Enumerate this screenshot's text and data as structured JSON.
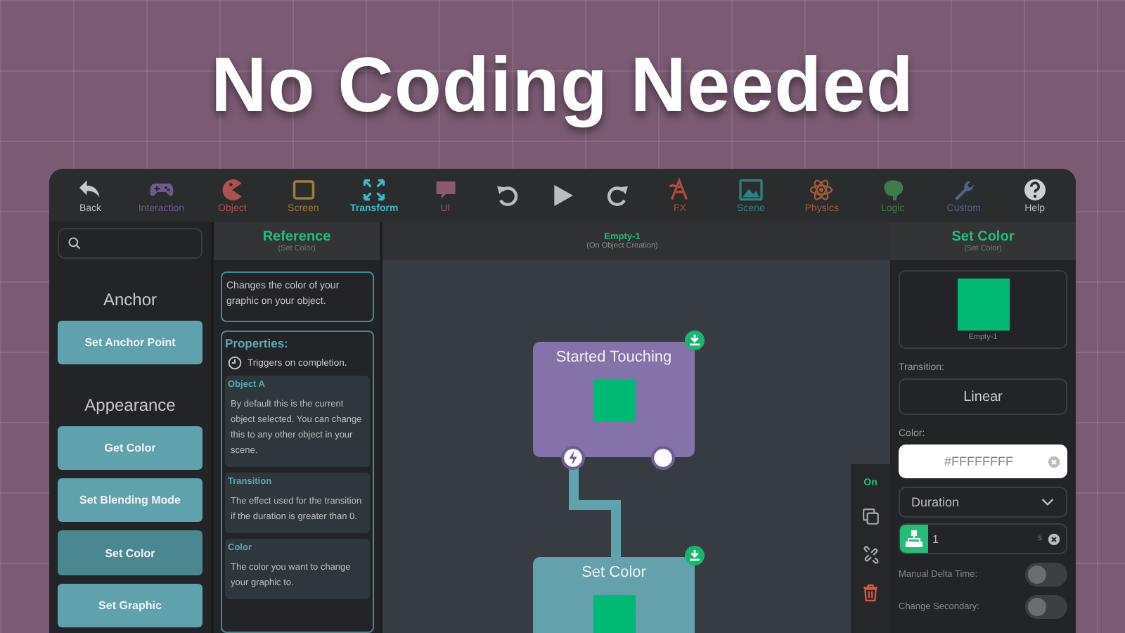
{
  "headline": "No Coding Needed",
  "toolbar": [
    {
      "kind": "nav",
      "label": "Back",
      "color": "#c9c9c9"
    },
    {
      "kind": "tool",
      "label": "Interaction",
      "color": "#6a5b8c",
      "selected": false
    },
    {
      "kind": "tool",
      "label": "Object",
      "color": "#a9524f",
      "selected": false
    },
    {
      "kind": "tool",
      "label": "Screen",
      "color": "#a27b36",
      "selected": false
    },
    {
      "kind": "tool",
      "label": "Transform",
      "color": "#3fb7c8",
      "selected": true
    },
    {
      "kind": "tool",
      "label": "UI",
      "color": "#8a5a6c",
      "selected": false
    },
    {
      "kind": "action",
      "color": "#bdbdbd"
    },
    {
      "kind": "action",
      "color": "#bdbdbd"
    },
    {
      "kind": "action",
      "color": "#bdbdbd"
    },
    {
      "kind": "tool",
      "label": "FX",
      "color": "#b04a3c",
      "selected": false
    },
    {
      "kind": "tool",
      "label": "Scene",
      "color": "#2f8082",
      "selected": false
    },
    {
      "kind": "tool",
      "label": "Physics",
      "color": "#9c5b3b",
      "selected": false
    },
    {
      "kind": "tool",
      "label": "Logic",
      "color": "#3e7b4c",
      "selected": false
    },
    {
      "kind": "tool",
      "label": "Custom",
      "color": "#4a6585",
      "selected": false
    },
    {
      "kind": "nav",
      "label": "Help",
      "color": "#cfcfcf"
    }
  ],
  "palette": [
    {
      "kind": "heading",
      "text": "Anchor"
    },
    {
      "kind": "block",
      "text": "Set Anchor Point",
      "selected": false
    },
    {
      "kind": "heading",
      "text": "Appearance"
    },
    {
      "kind": "block",
      "text": "Get Color",
      "selected": false
    },
    {
      "kind": "block",
      "text": "Set Blending Mode",
      "selected": false
    },
    {
      "kind": "block",
      "text": "Set Color",
      "selected": true
    },
    {
      "kind": "block",
      "text": "Set Graphic",
      "selected": false
    }
  ],
  "reference": {
    "title": "Reference",
    "subtitle": "(Set Color)",
    "description": "Changes the color of your graphic on your object.",
    "properties_title": "Properties:",
    "trigger": "Triggers on completion.",
    "sections": [
      {
        "title": "Object A",
        "body": "By default this is the current object selected. You can change this to any other object in your scene."
      },
      {
        "title": "Transition",
        "body": "The effect used for the transition if the duration is greater than 0."
      },
      {
        "title": "Color",
        "body": "The color you want to change your graphic to."
      }
    ]
  },
  "canvas": {
    "title": "Empty-1",
    "subtitle": "(On Object Creation)",
    "nodes": [
      {
        "kind": "event",
        "title": "Started Touching",
        "color": "#8473a8"
      },
      {
        "kind": "action",
        "title": "Set Color",
        "color": "#63a1ac"
      }
    ],
    "side_tools": [
      {
        "kind": "toggle",
        "label": "On",
        "on": true
      },
      {
        "kind": "copy"
      },
      {
        "kind": "unlink"
      },
      {
        "kind": "delete"
      }
    ]
  },
  "inspector": {
    "title": "Set Color",
    "subtitle": "(Set Color)",
    "preview_caption": "Empty-1",
    "transition_label": "Transition:",
    "transition": "Linear",
    "color_label": "Color:",
    "color_value": "#FFFFFFFF",
    "mode": "Duration",
    "duration": "1",
    "unit": "s",
    "toggles": [
      {
        "label": "Manual Delta Time:",
        "on": false
      },
      {
        "label": "Change Secondary:",
        "on": false
      }
    ]
  }
}
